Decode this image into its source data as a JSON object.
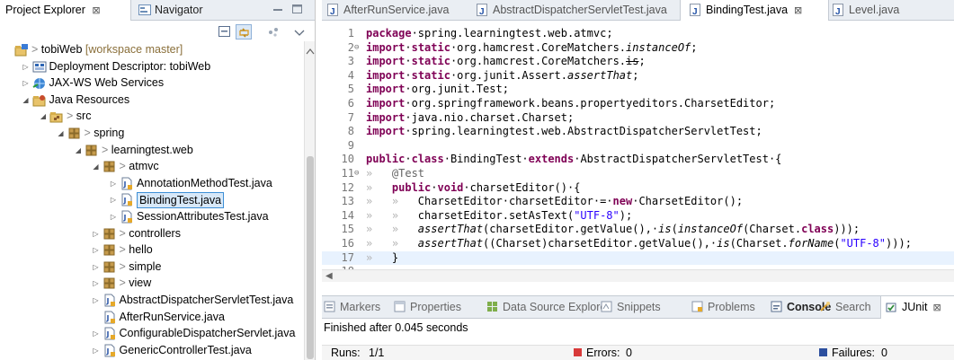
{
  "left_panel": {
    "tabs": [
      {
        "label": "Project Explorer",
        "close": "⊠"
      },
      {
        "label": "Navigator"
      }
    ]
  },
  "tree": [
    {
      "indent": 0,
      "twisty": "",
      "icon": "project-icon",
      "decor": "> ",
      "label": "tobiWeb",
      "suffix": " [workspace master]"
    },
    {
      "indent": 1,
      "twisty": "▷",
      "icon": "deployment-descriptor-icon",
      "decor": "",
      "label": "Deployment Descriptor: tobiWeb",
      "suffix": ""
    },
    {
      "indent": 1,
      "twisty": "▷",
      "icon": "jaxws-icon",
      "decor": "",
      "label": "JAX-WS Web Services",
      "suffix": ""
    },
    {
      "indent": 1,
      "twisty": "◢",
      "icon": "java-resources-icon",
      "decor": "",
      "label": "Java Resources",
      "suffix": ""
    },
    {
      "indent": 2,
      "twisty": "◢",
      "icon": "source-folder-icon",
      "decor": "> ",
      "label": "src",
      "suffix": ""
    },
    {
      "indent": 3,
      "twisty": "◢",
      "icon": "package-icon",
      "decor": "> ",
      "label": "spring",
      "suffix": ""
    },
    {
      "indent": 4,
      "twisty": "◢",
      "icon": "package-icon",
      "decor": "> ",
      "label": "learningtest.web",
      "suffix": ""
    },
    {
      "indent": 5,
      "twisty": "◢",
      "icon": "package-icon",
      "decor": "> ",
      "label": "atmvc",
      "suffix": ""
    },
    {
      "indent": 6,
      "twisty": "▷",
      "icon": "java-file-icon",
      "decor": "",
      "label": "AnnotationMethodTest.java",
      "suffix": ""
    },
    {
      "indent": 6,
      "twisty": "▷",
      "icon": "java-file-icon",
      "decor": "",
      "label": "BindingTest.java",
      "suffix": "",
      "selected": true
    },
    {
      "indent": 6,
      "twisty": "▷",
      "icon": "java-file-icon",
      "decor": "",
      "label": "SessionAttributesTest.java",
      "suffix": ""
    },
    {
      "indent": 5,
      "twisty": "▷",
      "icon": "package-icon",
      "decor": "> ",
      "label": "controllers",
      "suffix": ""
    },
    {
      "indent": 5,
      "twisty": "▷",
      "icon": "package-icon",
      "decor": "> ",
      "label": "hello",
      "suffix": ""
    },
    {
      "indent": 5,
      "twisty": "▷",
      "icon": "package-icon",
      "decor": "> ",
      "label": "simple",
      "suffix": ""
    },
    {
      "indent": 5,
      "twisty": "▷",
      "icon": "package-icon",
      "decor": "> ",
      "label": "view",
      "suffix": ""
    },
    {
      "indent": 5,
      "twisty": "▷",
      "icon": "java-file-icon",
      "decor": "",
      "label": "AbstractDispatcherServletTest.java",
      "suffix": ""
    },
    {
      "indent": 5,
      "twisty": "",
      "icon": "java-file-icon",
      "decor": "",
      "label": "AfterRunService.java",
      "suffix": ""
    },
    {
      "indent": 5,
      "twisty": "▷",
      "icon": "java-file-icon",
      "decor": "",
      "label": "ConfigurableDispatcherServlet.java",
      "suffix": ""
    },
    {
      "indent": 5,
      "twisty": "▷",
      "icon": "java-file-icon",
      "decor": "",
      "label": "GenericControllerTest.java",
      "suffix": ""
    }
  ],
  "editor": {
    "tabs": [
      {
        "label": "AfterRunService.java",
        "active": false
      },
      {
        "label": "AbstractDispatcherServletTest.java",
        "active": false
      },
      {
        "label": "BindingTest.java",
        "active": true,
        "close": "⊠"
      },
      {
        "label": "Level.java",
        "active": false
      }
    ],
    "lines": [
      {
        "n": "1",
        "fold": "",
        "segs": [
          [
            "kw",
            "package"
          ],
          [
            "",
            "·spring.learningtest.web.atmvc;"
          ]
        ]
      },
      {
        "n": "2",
        "fold": "⊖",
        "segs": [
          [
            "kw",
            "import"
          ],
          [
            "",
            "·"
          ],
          [
            "kw",
            "static"
          ],
          [
            "",
            "·org.hamcrest.CoreMatchers."
          ],
          [
            "it",
            "instanceOf"
          ],
          [
            "",
            ";"
          ]
        ]
      },
      {
        "n": "3",
        "fold": "",
        "segs": [
          [
            "kw",
            "import"
          ],
          [
            "",
            "·"
          ],
          [
            "kw",
            "static"
          ],
          [
            "",
            "·org.hamcrest.CoreMatchers."
          ],
          [
            "strk",
            "is"
          ],
          [
            "",
            ";"
          ]
        ]
      },
      {
        "n": "4",
        "fold": "",
        "segs": [
          [
            "kw",
            "import"
          ],
          [
            "",
            "·"
          ],
          [
            "kw",
            "static"
          ],
          [
            "",
            "·org.junit.Assert."
          ],
          [
            "it",
            "assertThat"
          ],
          [
            "",
            ";"
          ]
        ]
      },
      {
        "n": "5",
        "fold": "",
        "segs": [
          [
            "kw",
            "import"
          ],
          [
            "",
            "·org.junit.Test;"
          ]
        ]
      },
      {
        "n": "6",
        "fold": "",
        "segs": [
          [
            "kw",
            "import"
          ],
          [
            "",
            "·org.springframework.beans.propertyeditors.CharsetEditor;"
          ]
        ]
      },
      {
        "n": "7",
        "fold": "",
        "segs": [
          [
            "kw",
            "import"
          ],
          [
            "",
            "·java.nio.charset.Charset;"
          ]
        ]
      },
      {
        "n": "8",
        "fold": "",
        "segs": [
          [
            "kw",
            "import"
          ],
          [
            "",
            "·spring.learningtest.web.AbstractDispatcherServletTest;"
          ]
        ]
      },
      {
        "n": "9",
        "fold": "",
        "segs": []
      },
      {
        "n": "10",
        "fold": "",
        "segs": [
          [
            "kw",
            "public"
          ],
          [
            "",
            "·"
          ],
          [
            "kw",
            "class"
          ],
          [
            "",
            "·BindingTest·"
          ],
          [
            "kw",
            "extends"
          ],
          [
            "",
            "·AbstractDispatcherServletTest·{"
          ]
        ]
      },
      {
        "n": "11",
        "fold": "⊖",
        "segs": [
          [
            "ar",
            "»   "
          ],
          [
            "an",
            "@Test"
          ]
        ]
      },
      {
        "n": "12",
        "fold": "",
        "segs": [
          [
            "ar",
            "»   "
          ],
          [
            "kw",
            "public"
          ],
          [
            "",
            "·"
          ],
          [
            "kw",
            "void"
          ],
          [
            "",
            "·charsetEditor()·{"
          ]
        ]
      },
      {
        "n": "13",
        "fold": "",
        "segs": [
          [
            "ar",
            "»   »   "
          ],
          [
            "",
            "CharsetEditor·charsetEditor·=·"
          ],
          [
            "kw",
            "new"
          ],
          [
            "",
            "·CharsetEditor();"
          ]
        ]
      },
      {
        "n": "14",
        "fold": "",
        "segs": [
          [
            "ar",
            "»   »   "
          ],
          [
            "",
            "charsetEditor.setAsText("
          ],
          [
            "st",
            "\"UTF-8\""
          ],
          [
            "",
            ");"
          ]
        ]
      },
      {
        "n": "15",
        "fold": "",
        "segs": [
          [
            "ar",
            "»   »   "
          ],
          [
            "it",
            "assertThat"
          ],
          [
            "",
            "(charsetEditor.getValue(),·"
          ],
          [
            "it",
            "is"
          ],
          [
            "",
            "("
          ],
          [
            "it",
            "instanceOf"
          ],
          [
            "",
            "(Charset."
          ],
          [
            "kw",
            "class"
          ],
          [
            "",
            ")));"
          ]
        ]
      },
      {
        "n": "16",
        "fold": "",
        "segs": [
          [
            "ar",
            "»   »   "
          ],
          [
            "it",
            "assertThat"
          ],
          [
            "",
            "((Charset)charsetEditor.getValue(),·"
          ],
          [
            "it",
            "is"
          ],
          [
            "",
            "(Charset."
          ],
          [
            "it",
            "forName"
          ],
          [
            "",
            "("
          ],
          [
            "st",
            "\"UTF-8\""
          ],
          [
            "",
            ")));"
          ]
        ]
      },
      {
        "n": "17",
        "fold": "",
        "segs": [
          [
            "ar",
            "»   "
          ],
          [
            "",
            "}"
          ]
        ],
        "current": true
      },
      {
        "n": "18",
        "fold": "",
        "segs": []
      }
    ]
  },
  "bottom": {
    "tabs": [
      {
        "label": "Markers",
        "icon": "markers-icon"
      },
      {
        "label": "Properties",
        "icon": "properties-icon"
      },
      {
        "label": "Data Source Explorer",
        "icon": "data-source-icon"
      },
      {
        "label": "Snippets",
        "icon": "snippets-icon"
      },
      {
        "label": "Problems",
        "icon": "problems-icon"
      },
      {
        "label": "Console",
        "icon": "console-icon",
        "bold": true
      },
      {
        "label": "Search",
        "icon": "search-icon"
      },
      {
        "label": "JUnit",
        "icon": "junit-icon",
        "active": true,
        "close": "⊠"
      }
    ],
    "status": "Finished after 0.045 seconds",
    "runs_label": "Runs:",
    "runs_value": "1/1",
    "errors_label": "Errors:",
    "errors_value": "0",
    "failures_label": "Failures:",
    "failures_value": "0"
  },
  "colors": {
    "keyword": "#7f0055",
    "string": "#2a00ff",
    "annotation": "#646464",
    "selection_border": "#3d8fd6",
    "error_square": "#d83a3a",
    "failure_square": "#2c4f9e"
  }
}
